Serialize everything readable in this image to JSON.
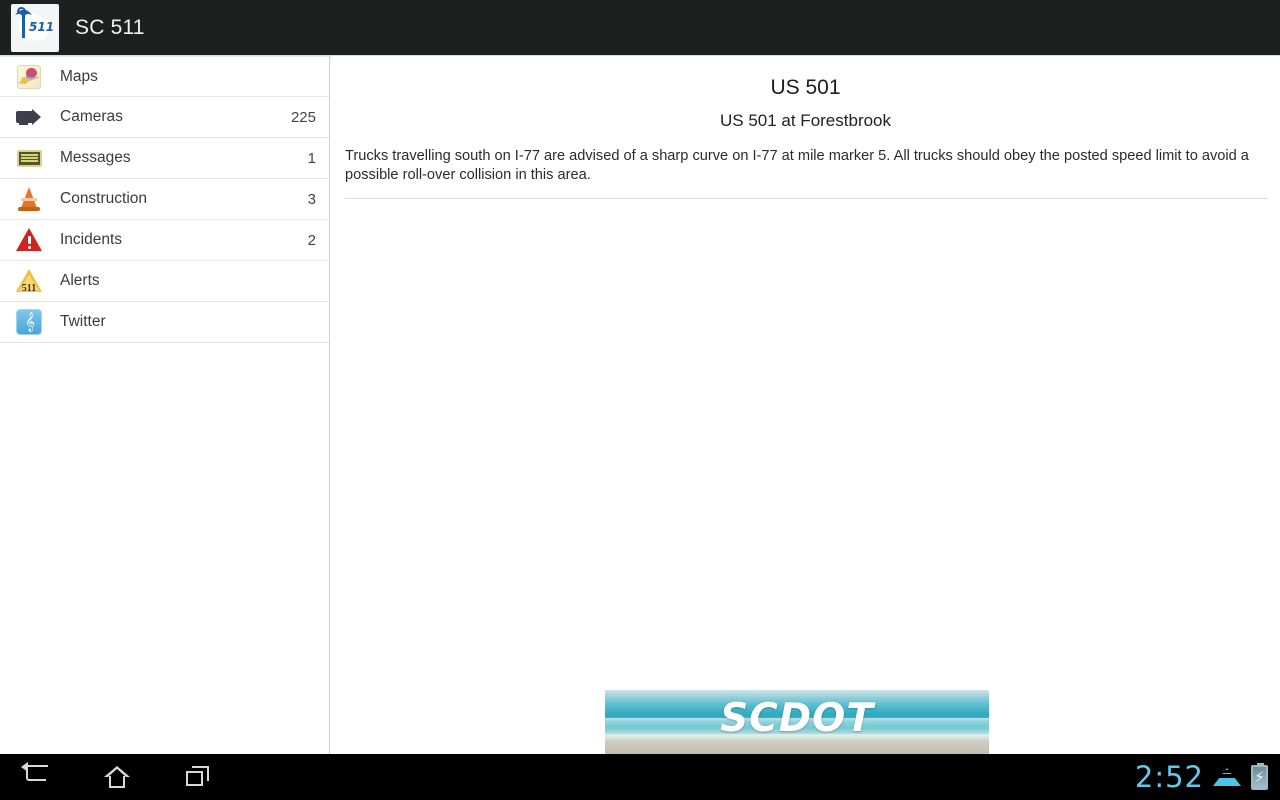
{
  "header": {
    "app_title": "SC 511",
    "logo_text": "511",
    "logo_name": "sc-511-logo"
  },
  "sidebar": {
    "items": [
      {
        "label": "Maps",
        "count": "",
        "icon": "maps-icon"
      },
      {
        "label": "Cameras",
        "count": "225",
        "icon": "camera-icon"
      },
      {
        "label": "Messages",
        "count": "1",
        "icon": "message-sign-icon"
      },
      {
        "label": "Construction",
        "count": "3",
        "icon": "traffic-cone-icon"
      },
      {
        "label": "Incidents",
        "count": "2",
        "icon": "warning-triangle-icon"
      },
      {
        "label": "Alerts",
        "count": "",
        "icon": "alert-511-icon"
      },
      {
        "label": "Twitter",
        "count": "",
        "icon": "twitter-icon"
      }
    ]
  },
  "content": {
    "title": "US 501",
    "subtitle": "US 501 at Forestbrook",
    "body": "Trucks travelling south on I-77 are advised of a sharp curve on I-77 at mile marker 5. All trucks should obey the posted speed limit to avoid a possible roll-over collision in this area."
  },
  "banner": {
    "text": "SCDOT",
    "alt": "scdot-beach-banner"
  },
  "navbar": {
    "back": "back-button",
    "home": "home-button",
    "recents": "recent-apps-button"
  },
  "status": {
    "clock": "2:52",
    "wifi": "wifi-icon",
    "battery": "battery-charging-icon",
    "battery_glyph": "⚡"
  },
  "colors": {
    "header_bg": "#1e1f1f",
    "navbar_bg": "#000000",
    "clock": "#63c9e8",
    "accent_blue": "#1a5fa8"
  }
}
